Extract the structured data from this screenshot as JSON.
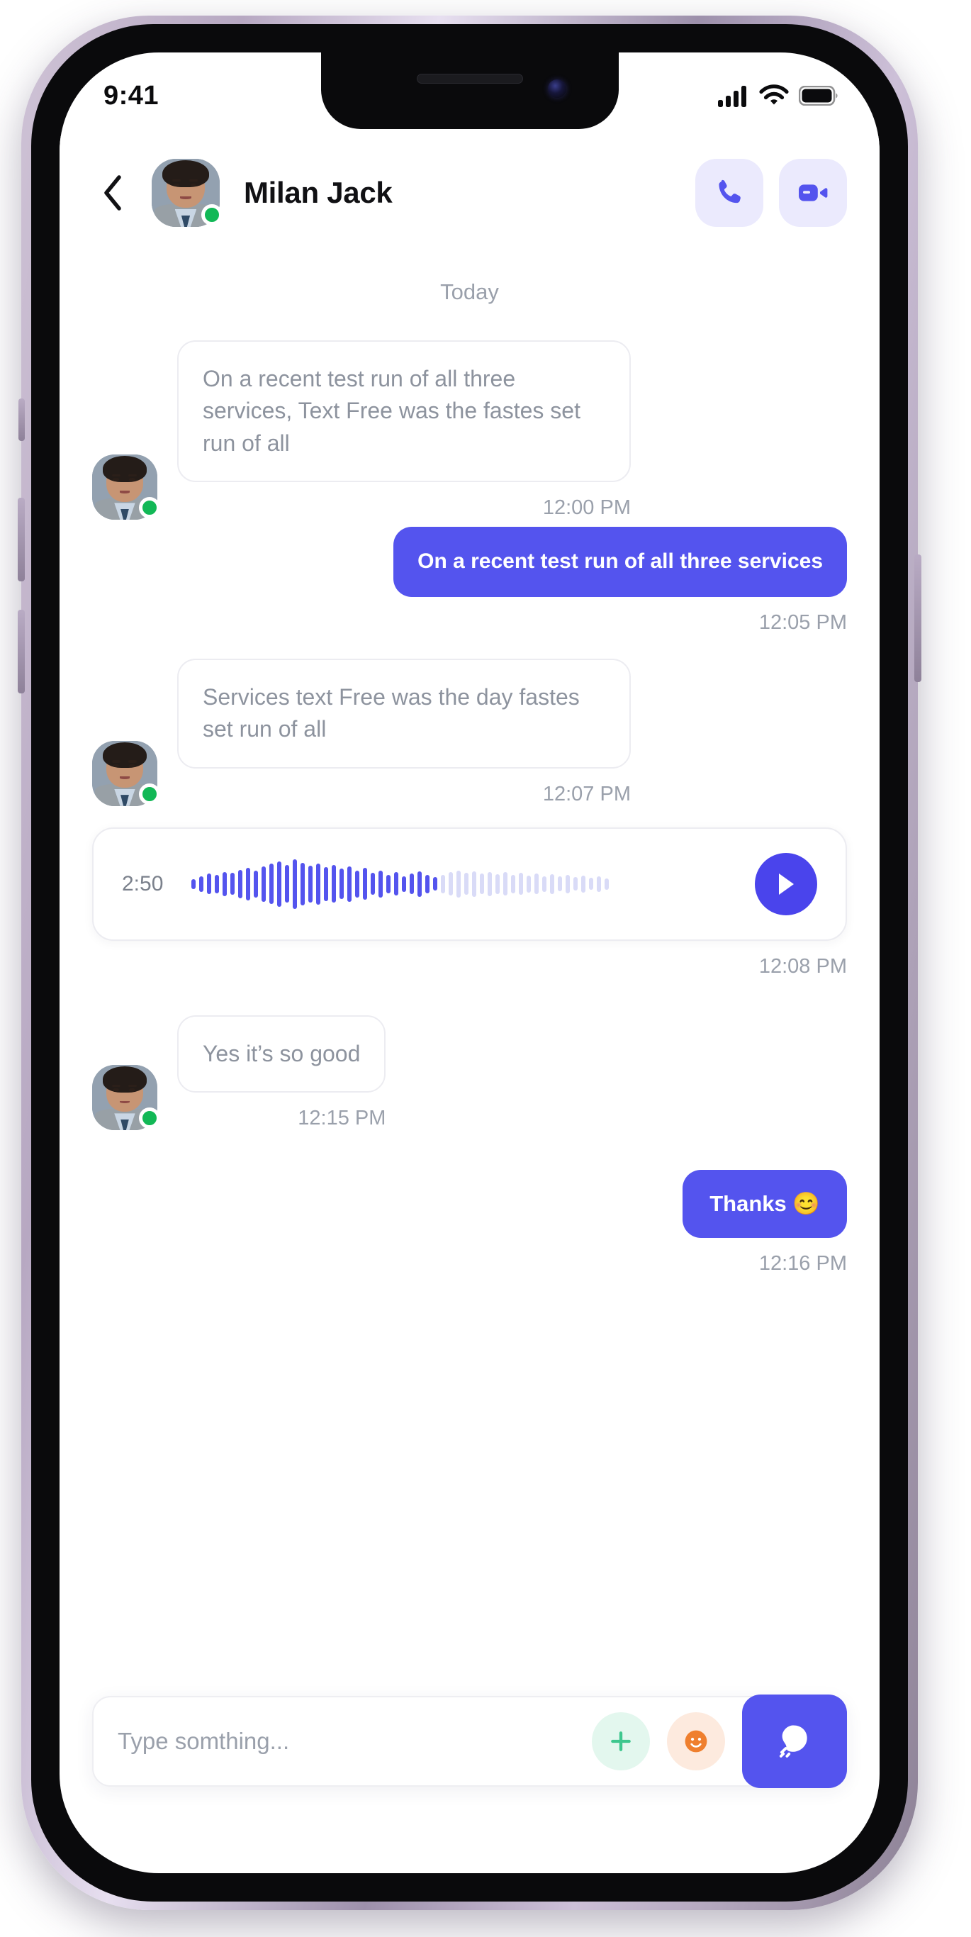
{
  "status_bar": {
    "time": "9:41",
    "icons": [
      "cellular-signal-icon",
      "wifi-icon",
      "battery-icon"
    ]
  },
  "header": {
    "back_icon": "chevron-left-icon",
    "contact_name": "Milan Jack",
    "presence": "online",
    "avatar_name": "contact-avatar",
    "actions": [
      {
        "name": "voice-call-button",
        "icon": "phone-icon"
      },
      {
        "name": "video-call-button",
        "icon": "video-camera-icon"
      }
    ]
  },
  "conversation": {
    "day_divider": "Today",
    "messages": [
      {
        "type": "text",
        "direction": "incoming",
        "text": "On a recent test run of all three services, Text Free was the fastes set run of all",
        "time": "12:00 PM"
      },
      {
        "type": "text",
        "direction": "outgoing",
        "text": "On a recent test run of all three services",
        "time": "12:05 PM"
      },
      {
        "type": "text",
        "direction": "incoming",
        "text": "Services text Free was the day fastes set run of all",
        "time": "12:07 PM"
      },
      {
        "type": "audio",
        "direction": "incoming",
        "duration": "2:50",
        "play_icon": "play-icon",
        "time": "12:08 PM"
      },
      {
        "type": "text",
        "direction": "incoming",
        "text": "Yes it’s so good",
        "time": "12:15 PM"
      },
      {
        "type": "text",
        "direction": "outgoing",
        "text": "Thanks 😊",
        "time": "12:16 PM"
      }
    ]
  },
  "composer": {
    "placeholder": "Type somthing...",
    "value": "",
    "attach_icon": "plus-icon",
    "emoji_icon": "smiley-icon",
    "send_icon": "send-chat-icon"
  },
  "colors": {
    "accent": "#5454ee",
    "accent_soft": "#ebeafd",
    "online": "#12b856",
    "bubble_in_border": "#ececf1",
    "text_muted": "#9aa0ab",
    "plus_bg": "#e3f7ee",
    "plus_fg": "#3ec78e",
    "emoji_bg": "#fdeade",
    "emoji_fg": "#ef7f2e",
    "wave_active": "#5454ee",
    "wave_inactive": "#d9dbf7"
  },
  "audio_waveform": {
    "bars": [
      16,
      26,
      34,
      30,
      40,
      36,
      46,
      54,
      44,
      58,
      66,
      74,
      62,
      82,
      70,
      60,
      68,
      56,
      62,
      50,
      58,
      44,
      52,
      36,
      44,
      30,
      38,
      26,
      34,
      42,
      30,
      22,
      30,
      38,
      44,
      36,
      42,
      34,
      40,
      32,
      38,
      30,
      36,
      28,
      34,
      26,
      32,
      24,
      30,
      22,
      28,
      20,
      26,
      18
    ],
    "played_count": 32
  }
}
